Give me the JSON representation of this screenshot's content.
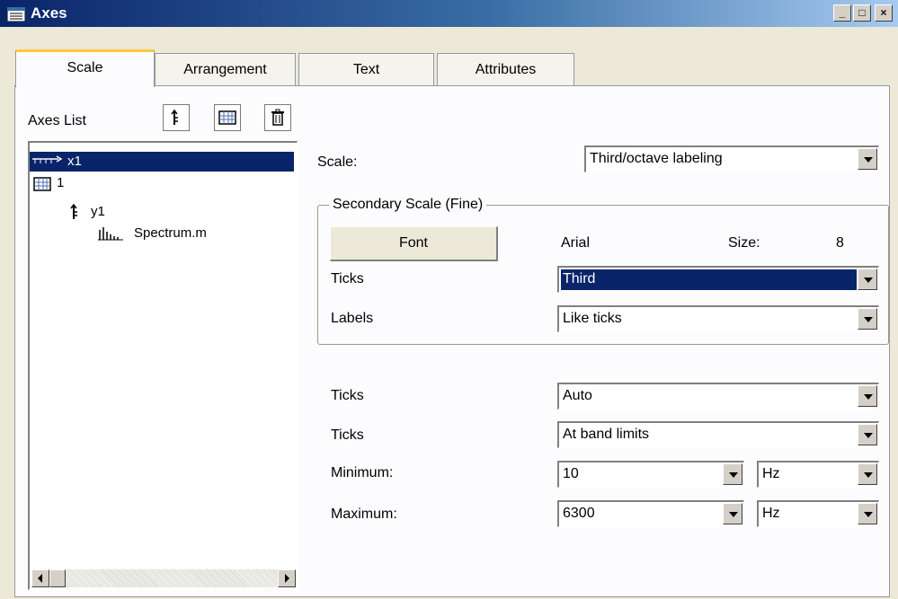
{
  "window": {
    "title": "Axes",
    "minimize_glyph": "_",
    "maximize_glyph": "□",
    "close_glyph": "×"
  },
  "tabs": [
    {
      "label": "Scale"
    },
    {
      "label": "Arrangement"
    },
    {
      "label": "Text"
    },
    {
      "label": "Attributes"
    }
  ],
  "axes_list": {
    "label": "Axes List",
    "toolbar": [
      "axis-icon",
      "grid-icon",
      "trash-icon"
    ],
    "items": [
      {
        "label": "x1",
        "icon": "x-axis-icon",
        "selected": true
      },
      {
        "label": "1",
        "icon": "system-grid-icon"
      },
      {
        "label": "y1",
        "icon": "y-axis-icon"
      },
      {
        "label": "Spectrum.m",
        "icon": "spectrum-icon"
      }
    ]
  },
  "scale": {
    "label": "Scale:",
    "value": "Third/octave labeling"
  },
  "secondary": {
    "title": "Secondary Scale (Fine)",
    "font_button": "Font",
    "font_name": "Arial",
    "size_label": "Size:",
    "size_value": "8",
    "ticks_label": "Ticks",
    "ticks_value": "Third",
    "labels_label": "Labels",
    "labels_value": "Like ticks"
  },
  "primary": {
    "ticks1_label": "Ticks",
    "ticks1_value": "Auto",
    "ticks2_label": "Ticks",
    "ticks2_value": "At band limits",
    "minimum_label": "Minimum:",
    "minimum_value": "10",
    "minimum_unit": "Hz",
    "maximum_label": "Maximum:",
    "maximum_value": "6300",
    "maximum_unit": "Hz"
  },
  "colors": {
    "selection": "#0a246a",
    "title_start": "#0a246a",
    "tab_accent": "#ffc83c"
  }
}
